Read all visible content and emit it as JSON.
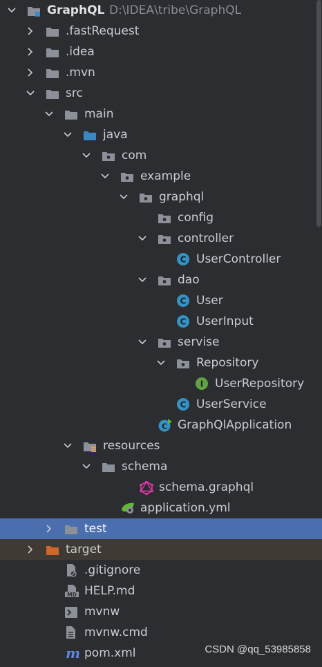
{
  "tree": [
    {
      "level": 0,
      "arrow": "down",
      "icon": "module-folder-icon",
      "label": "GraphQL",
      "sub": "D:\\IDEA\\tribe\\GraphQL",
      "bold": true
    },
    {
      "level": 1,
      "arrow": "right",
      "icon": "folder-icon",
      "label": ".fastRequest"
    },
    {
      "level": 1,
      "arrow": "right",
      "icon": "folder-icon",
      "label": ".idea"
    },
    {
      "level": 1,
      "arrow": "right",
      "icon": "folder-icon",
      "label": ".mvn"
    },
    {
      "level": 1,
      "arrow": "down",
      "icon": "folder-icon",
      "label": "src"
    },
    {
      "level": 2,
      "arrow": "down",
      "icon": "folder-icon",
      "label": "main"
    },
    {
      "level": 3,
      "arrow": "down",
      "icon": "source-folder-icon",
      "label": "java"
    },
    {
      "level": 4,
      "arrow": "down",
      "icon": "package-icon",
      "label": "com"
    },
    {
      "level": 5,
      "arrow": "down",
      "icon": "package-icon",
      "label": "example"
    },
    {
      "level": 6,
      "arrow": "down",
      "icon": "package-icon",
      "label": "graphql"
    },
    {
      "level": 7,
      "arrow": "none",
      "icon": "package-icon",
      "label": "config"
    },
    {
      "level": 7,
      "arrow": "down",
      "icon": "package-icon",
      "label": "controller"
    },
    {
      "level": 8,
      "arrow": "none",
      "icon": "class-icon",
      "label": "UserController"
    },
    {
      "level": 7,
      "arrow": "down",
      "icon": "package-icon",
      "label": "dao"
    },
    {
      "level": 8,
      "arrow": "none",
      "icon": "class-icon",
      "label": "User"
    },
    {
      "level": 8,
      "arrow": "none",
      "icon": "class-icon",
      "label": "UserInput"
    },
    {
      "level": 7,
      "arrow": "down",
      "icon": "package-icon",
      "label": "servise"
    },
    {
      "level": 8,
      "arrow": "down",
      "icon": "package-icon",
      "label": "Repository"
    },
    {
      "level": 9,
      "arrow": "none",
      "icon": "interface-icon",
      "label": "UserRepository"
    },
    {
      "level": 8,
      "arrow": "none",
      "icon": "class-icon",
      "label": "UserService"
    },
    {
      "level": 7,
      "arrow": "none",
      "icon": "spring-boot-class-icon",
      "label": "GraphQlApplication"
    },
    {
      "level": 3,
      "arrow": "down",
      "icon": "resources-folder-icon",
      "label": "resources"
    },
    {
      "level": 4,
      "arrow": "down",
      "icon": "folder-icon",
      "label": "schema"
    },
    {
      "level": 6,
      "arrow": "none",
      "icon": "graphql-icon",
      "label": "schema.graphql"
    },
    {
      "level": 5,
      "arrow": "none",
      "icon": "spring-yml-icon",
      "label": "application.yml"
    },
    {
      "level": 2,
      "arrow": "right",
      "icon": "folder-icon",
      "label": "test",
      "selected": true
    },
    {
      "level": 1,
      "arrow": "right",
      "icon": "excluded-folder-icon",
      "label": "target",
      "excluded": true
    },
    {
      "level": 2,
      "arrow": "none",
      "icon": "gitignore-icon",
      "label": ".gitignore"
    },
    {
      "level": 2,
      "arrow": "none",
      "icon": "markdown-icon",
      "label": "HELP.md"
    },
    {
      "level": 2,
      "arrow": "none",
      "icon": "shell-script-icon",
      "label": "mvnw"
    },
    {
      "level": 2,
      "arrow": "none",
      "icon": "text-file-icon",
      "label": "mvnw.cmd"
    },
    {
      "level": 2,
      "arrow": "none",
      "icon": "maven-icon",
      "label": "pom.xml"
    }
  ],
  "watermark": "CSDN @qq_53985858",
  "colors": {
    "background": "#2b2d30",
    "selection": "#4b6eaf",
    "excluded_row": "#3f3a33",
    "folder": "#8c9099",
    "source_folder": "#3a88c4",
    "class_icon": "#3592c4",
    "interface_icon": "#62a244",
    "graphql": "#e535ab",
    "excluded_folder": "#d0672a"
  }
}
